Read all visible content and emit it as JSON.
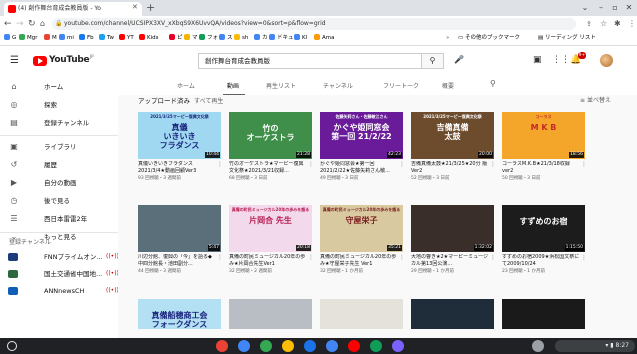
{
  "browser": {
    "tab_title": "(4) 創作舞台育成会教員版 - Yo",
    "url": "youtube.com/channel/UCSIPX3XV_xXbqS9X6UvvQA/videos?view=0&sort=p&flow=grid",
    "bookmarks": [
      {
        "label": "G",
        "color": "#4285f4"
      },
      {
        "label": "Mgr",
        "color": "#34a853"
      },
      {
        "label": "M",
        "color": "#ea4335"
      },
      {
        "label": "mi",
        "color": "#4285f4"
      },
      {
        "label": "Fb",
        "color": "#1877f2"
      },
      {
        "label": "Tw",
        "color": "#1da1f2"
      },
      {
        "label": "YT",
        "color": "#ff0000"
      },
      {
        "label": "Kids",
        "color": "#ff0000"
      },
      {
        "label": "ピ",
        "color": "#e60023"
      },
      {
        "label": "マ",
        "color": "#f4b400"
      },
      {
        "label": "フォ",
        "color": "#0f9d58"
      },
      {
        "label": "ス",
        "color": "#4285f4"
      },
      {
        "label": "sh",
        "color": "#fbbc05"
      },
      {
        "label": "カ",
        "color": "#4285f4"
      },
      {
        "label": "ドキュ",
        "color": "#4285f4"
      },
      {
        "label": "Kl",
        "color": "#4285f4"
      },
      {
        "label": "Ama",
        "color": "#ff9900"
      }
    ],
    "other_bookmarks": "その他のブックマーク",
    "reading_list": "リーディング リスト"
  },
  "youtube": {
    "logo_text": "YouTube",
    "logo_region": "JP",
    "search_value": "創作舞台育成会教員版",
    "notification_count": "9+"
  },
  "sidebar": {
    "items": [
      {
        "icon": "home-icon",
        "glyph": "⌂",
        "label": "ホーム"
      },
      {
        "icon": "compass-icon",
        "glyph": "◎",
        "label": "探索"
      },
      {
        "icon": "subscriptions-icon",
        "glyph": "▤",
        "label": "登録チャンネル"
      },
      {
        "icon": "library-icon",
        "glyph": "▣",
        "label": "ライブラリ"
      },
      {
        "icon": "history-icon",
        "glyph": "↺",
        "label": "履歴"
      },
      {
        "icon": "my-videos-icon",
        "glyph": "▶",
        "label": "自分の動画"
      },
      {
        "icon": "watch-later-icon",
        "glyph": "◷",
        "label": "後で見る"
      },
      {
        "icon": "playlist-icon",
        "glyph": "☰",
        "label": "西日本雷雷2年"
      },
      {
        "icon": "chevron-down-icon",
        "glyph": "⌄",
        "label": "もっと見る"
      }
    ],
    "subscriptions_title": "登録チャンネル",
    "subscriptions": [
      {
        "label": "FNNプライムオン...",
        "color": "#1a3c7a"
      },
      {
        "label": "国土交通省中国地...",
        "color": "#2a6a3c"
      },
      {
        "label": "ANNnewsCH",
        "color": "#0f5fb7"
      }
    ]
  },
  "channel_tabs": [
    "ホーム",
    "動画",
    "再生リスト",
    "チャンネル",
    "フリートーク",
    "概要"
  ],
  "section": {
    "heading": "アップロード済み",
    "play_all": "すべて再生",
    "sort": "並べ替え"
  },
  "videos_row1": [
    {
      "thumb_text": "真儀\nいきいき\nフラダンス",
      "thumb_sub": "2021/3/25マーピー復興文化祭",
      "bg": "#9fd8f0",
      "fg": "#1a237e",
      "duration": "10:44",
      "title": "真儀いきいきフラダンス 2021/3/4★動画回顧Ver3",
      "meta": "93 回視聴・3 週間前"
    },
    {
      "thumb_text": "竹の\nオーケストラ",
      "thumb_sub": "",
      "bg": "#3f8f4a",
      "fg": "#ffffff",
      "duration": "21:28",
      "title": "竹のオーケストラ★マーピー復興文化祭★2021/3/21収録...",
      "meta": "68 回視聴・3 日前"
    },
    {
      "thumb_text": "かぐや姫同窓会\n第一回 21/2/22",
      "thumb_sub": "佐藤矢莉さん・佐藤敏江さん",
      "bg": "#6a1b9a",
      "fg": "#ffffff",
      "duration": "42:23",
      "title": "かぐや姫同窓会★第一回 2021/2/22★佐藤矢莉さん敏...",
      "meta": "49 回視聴・3 日前"
    },
    {
      "thumb_text": "吉備真備\n太鼓",
      "thumb_sub": "2021/3/25マーピー復興文化祭",
      "bg": "#6d4c2e",
      "fg": "#ffffff",
      "duration": "20:00",
      "title": "吉備真備太鼓★21/3/25★20分 版 Ver2",
      "meta": "52 回視聴・3 日前"
    },
    {
      "thumb_text": "M K B",
      "thumb_sub": "コーラス",
      "bg": "#f4a62a",
      "fg": "#c62828",
      "duration": "18:56",
      "title": "コーラスM.K.B★21/3/18収録 ver2",
      "meta": "50 回視聴・3 日前"
    }
  ],
  "videos_row2": [
    {
      "thumb_text": "",
      "thumb_sub": "",
      "bg": "#5b6f7a",
      "fg": "#ffffff",
      "duration": "5:47",
      "title": "川辺分館、復興の「今」を語る◆中四分館長・池田副分...",
      "meta": "44 回視聴・3 週間前"
    },
    {
      "thumb_text": "片岡合 先生",
      "thumb_sub": "真備の町民ミュージカル20年の歩みを語る",
      "bg": "#f3d9ec",
      "fg": "#b71c50",
      "duration": "20:18",
      "title": "真備の町民ミュージカル20年の歩み★片岡合先生Ver1",
      "meta": "32 回視聴・2 週間前"
    },
    {
      "thumb_text": "守屋栄子",
      "thumb_sub": "真備の町民ミュージカル20年の歩みを語る",
      "bg": "#d9c9a0",
      "fg": "#7a1f1f",
      "duration": "35:21",
      "title": "真備の町民ミュージカル20年の歩み★守屋栄子先生 Ver1",
      "meta": "32 回視聴・1 か月前"
    },
    {
      "thumb_text": "",
      "thumb_sub": "",
      "bg": "#3a2e2a",
      "fg": "#ffffff",
      "duration": "1:32:02",
      "title": "大地の響き★2★マーピーミュージカル第13回公演...",
      "meta": "29 回視聴・1 か月前"
    },
    {
      "thumb_text": "すずめのお宿",
      "thumb_sub": "",
      "bg": "#1c1c1c",
      "fg": "#ffffff",
      "duration": "1:15:50",
      "title": "すずめのお宿2009★浜松国文祭にて2009/10/24",
      "meta": "23 回視聴・1 か月前"
    }
  ],
  "videos_row3": [
    {
      "thumb_text": "真備船穂商工会\nフォークダンス",
      "bg": "#b3e0f2",
      "fg": "#1a237e"
    },
    {
      "thumb_text": "",
      "bg": "#b9bec4",
      "fg": "#ffffff"
    },
    {
      "thumb_text": "",
      "bg": "#e5e2dc",
      "fg": "#333333"
    },
    {
      "thumb_text": "",
      "bg": "#1f2c3a",
      "fg": "#ffffff"
    },
    {
      "thumb_text": "",
      "bg": "#1a1a1a",
      "fg": "#ffffff"
    }
  ],
  "system": {
    "clock": "8:27"
  }
}
